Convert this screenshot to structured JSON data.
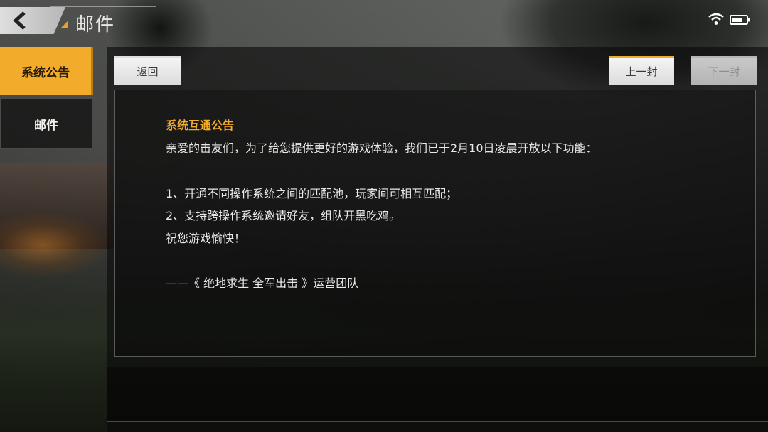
{
  "header": {
    "title": "邮件",
    "back_icon": "chevron-left-icon"
  },
  "status": {
    "wifi_icon": "wifi-icon",
    "battery_icon": "battery-icon"
  },
  "sidebar": {
    "items": [
      {
        "label": "系统公告",
        "active": true
      },
      {
        "label": "邮件",
        "active": false
      }
    ]
  },
  "toolbar": {
    "return_label": "返回",
    "prev_label": "上一封",
    "next_label": "下一封"
  },
  "message": {
    "title": "系统互通公告",
    "lines": [
      "亲爱的击友们，为了给您提供更好的游戏体验，我们已于2月10日凌晨开放以下功能：",
      "1、开通不同操作系统之间的匹配池，玩家间可相互匹配；",
      "2、支持跨操作系统邀请好友，组队开黑吃鸡。",
      "祝您游戏愉快！",
      "——《 绝地求生 全军出击 》运营团队"
    ]
  },
  "colors": {
    "accent": "#f3ab2b",
    "text": "#e8e8e8"
  }
}
